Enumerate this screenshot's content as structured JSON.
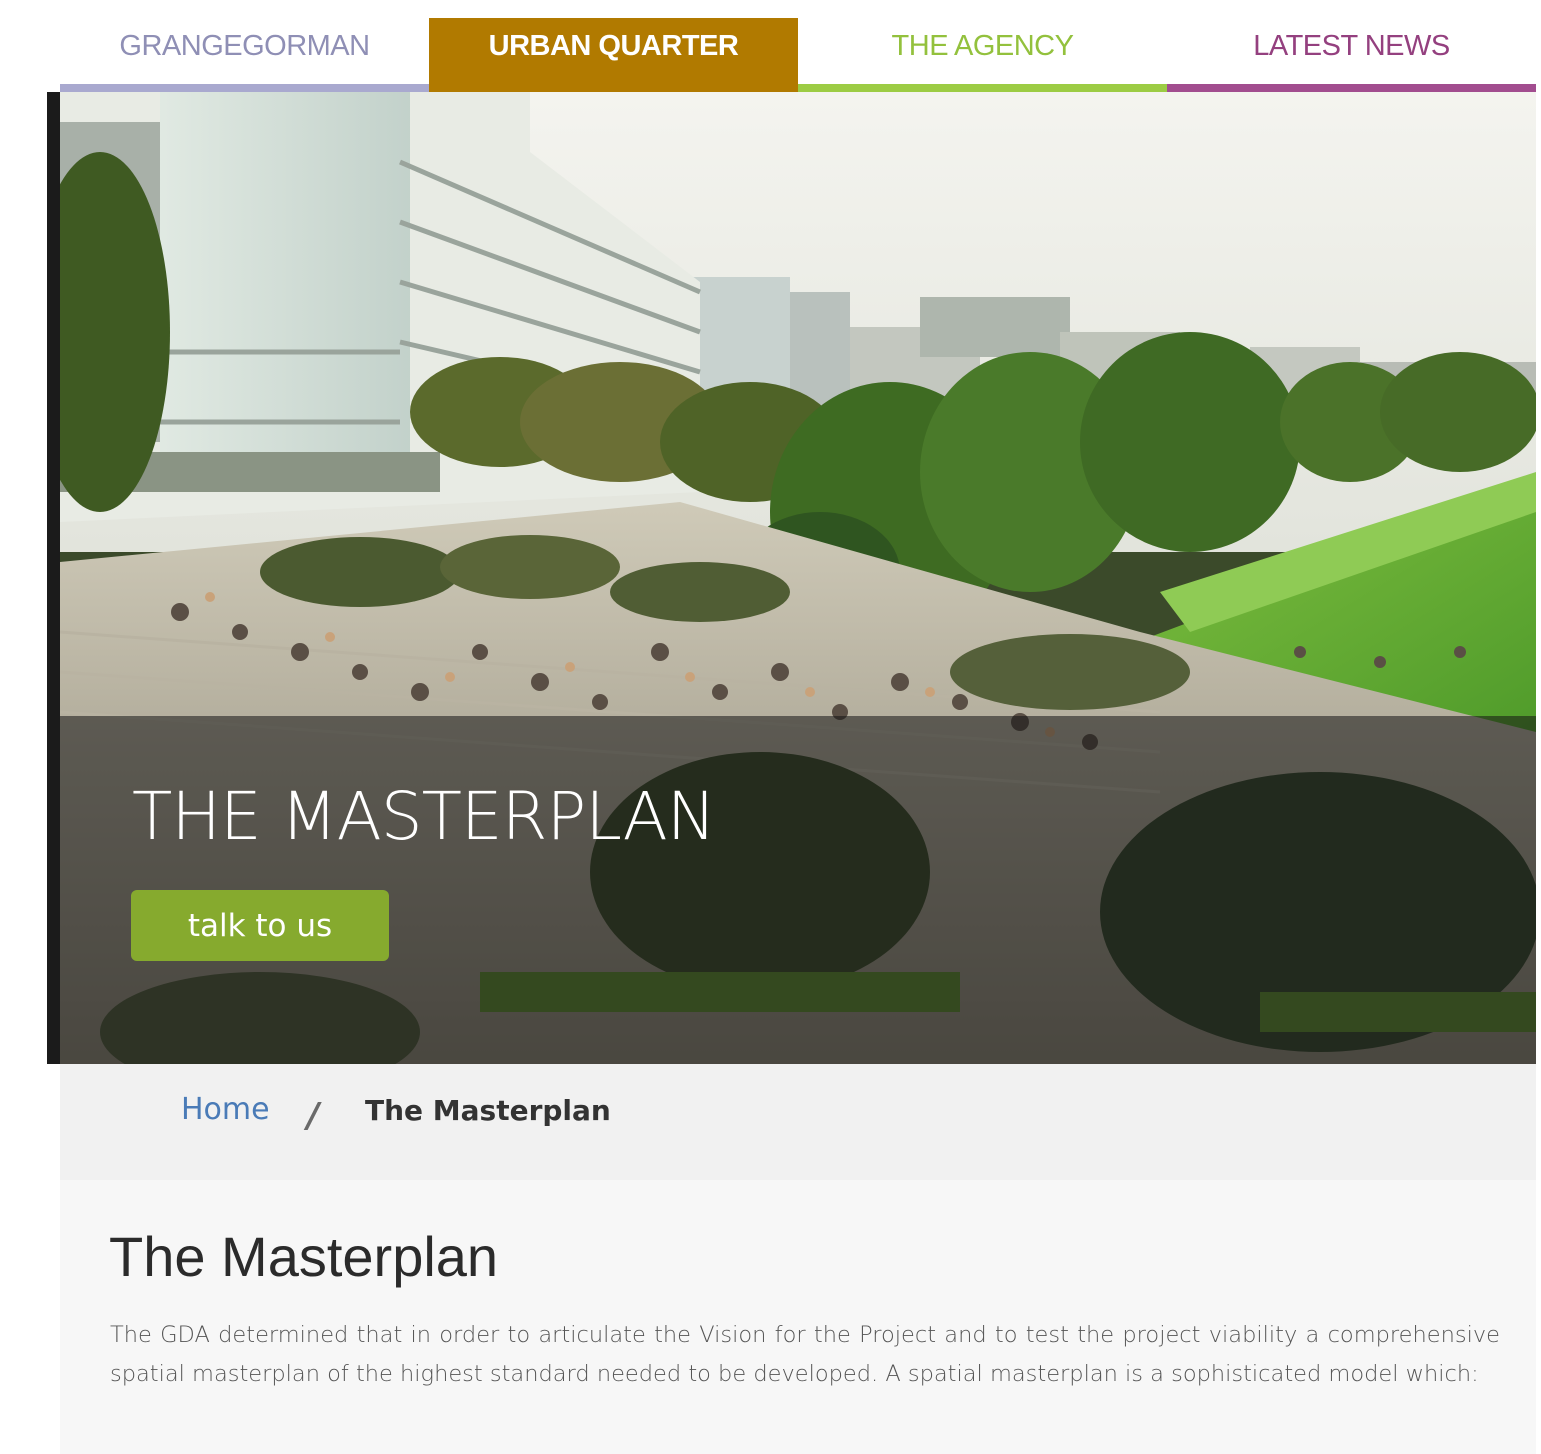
{
  "nav": {
    "tabs": [
      {
        "label": "GRANGEGORMAN",
        "color": "#8f8fb5",
        "bar": "#a9a9cf",
        "active": false
      },
      {
        "label": "URBAN QUARTER",
        "color": "#ffffff",
        "bar": "#b17a00",
        "active": true
      },
      {
        "label": "THE AGENCY",
        "color": "#93c13d",
        "bar": "#9ccc44",
        "active": false
      },
      {
        "label": "LATEST NEWS",
        "color": "#94407f",
        "bar": "#a24d8f",
        "active": false
      }
    ]
  },
  "hero": {
    "title": "THE MASTERPLAN",
    "cta_label": "talk to us",
    "cta_color": "#86aa2e"
  },
  "breadcrumb": {
    "home": "Home",
    "separator": "/",
    "current": "The Masterplan"
  },
  "content": {
    "title": "The Masterplan",
    "paragraph": "The GDA determined that in order to articulate the Vision for the Project and to test the project viability a comprehensive spatial masterplan of the highest standard needed to be developed. A spatial masterplan is a sophisticated model which:"
  }
}
